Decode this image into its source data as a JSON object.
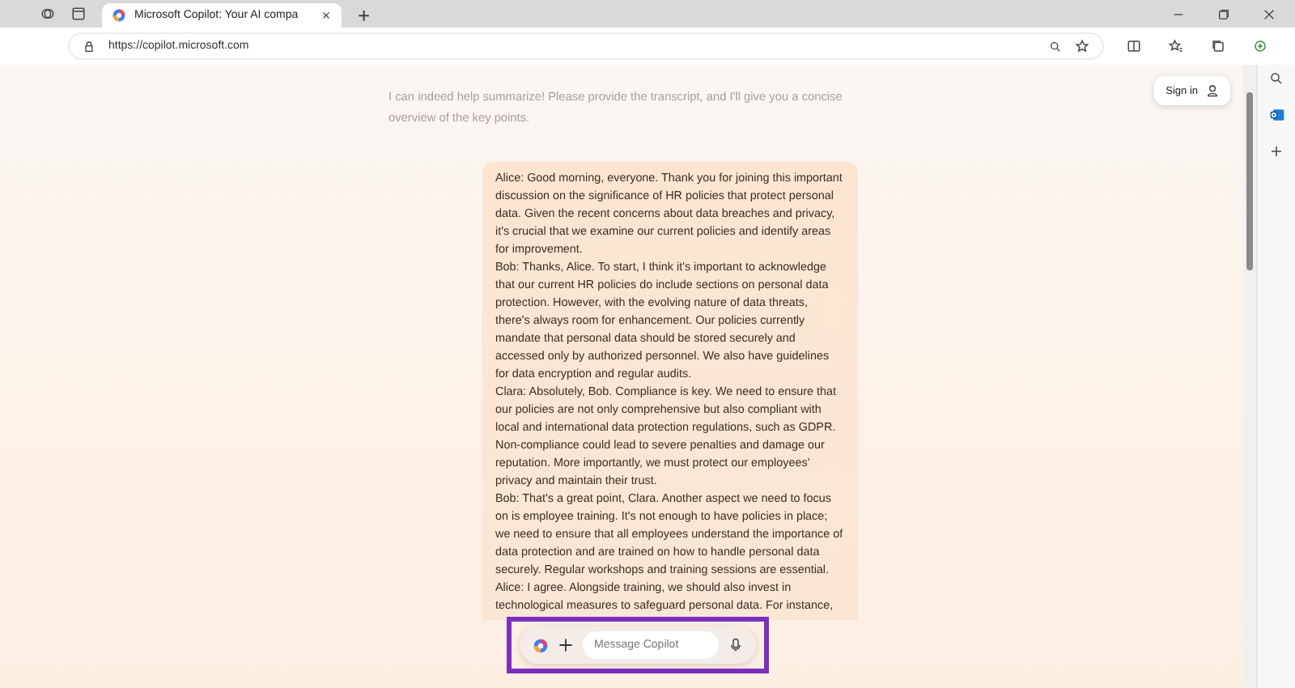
{
  "browser": {
    "tab": {
      "title": "Microsoft Copilot: Your AI compa",
      "selected": true
    },
    "new_tab": "+",
    "url": "https://copilot.microsoft.com"
  },
  "sign_in": "Sign in",
  "assistant_message": "I can indeed help summarize! Please provide the transcript, and I'll give you a concise overview of the key points.",
  "user_message": [
    "Alice: Good morning, everyone. Thank you for joining this important discussion on the significance of HR policies that protect personal data. Given the recent concerns about data breaches and privacy, it's crucial that we examine our current policies and identify areas for improvement.",
    "Bob: Thanks, Alice. To start, I think it's important to acknowledge that our current HR policies do include sections on personal data protection. However, with the evolving nature of data threats, there's always room for enhancement. Our policies currently mandate that personal data should be stored securely and accessed only by authorized personnel. We also have guidelines for data encryption and regular audits.",
    "Clara: Absolutely, Bob. Compliance is key. We need to ensure that our policies are not only comprehensive but also compliant with local and international data protection regulations, such as GDPR. Non-compliance could lead to severe penalties and damage our reputation. More importantly, we must protect our employees' privacy and maintain their trust.",
    "Bob: That's a great point, Clara. Another aspect we need to focus on is employee training. It's not enough to have policies in place; we need to ensure that all employees understand the importance of data protection and are trained on how to handle personal data securely. Regular workshops and training sessions are essential.",
    "Alice: I agree. Alongside training, we should also invest in technological measures to safeguard personal data. For instance,"
  ],
  "composer": {
    "placeholder": "Message Copilot",
    "highlighted": true
  }
}
